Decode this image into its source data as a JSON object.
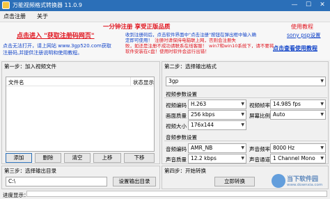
{
  "window": {
    "title": "万能视频格式转换器 11.0.9",
    "min": "—",
    "max": "☐",
    "close": "✕"
  },
  "menu": [
    "点击注册",
    "关于"
  ],
  "promo": {
    "headline": "一分钟注册   享受正版品质",
    "register_link": "点击进入 \"获取注册码网页\"",
    "line_left_1": "点击无法打开，请上网站 www.3gp520.com获取",
    "line_left_2": "注册码,并提供注册说明和使用教程。",
    "line_mid_1": "收到注册码后，点击软件界面中\"点击注册\"按钮在弹出框中输入确",
    "line_mid_2": "定即可使用！",
    "line_mid_red_1": "注册时请保持电脑联上网，否则会注册失",
    "line_mid_red_2": "败，如还是注册不成功请联系在线客服！",
    "line_mid_red_3": "win7和win10系统下，请不要将",
    "line_mid_red_4": "软件安装在c盘！使用时软件会运行出错！",
    "tutorial": "使用教程",
    "settings_link": "sony psp设置",
    "view_tutorial": "点击查看使用教程"
  },
  "step1": {
    "title": "第一步：加入视频文件",
    "col_file": "文件名",
    "col_status": "状态显示",
    "buttons": [
      "添加",
      "删除",
      "清空",
      "上移",
      "下移"
    ]
  },
  "step2": {
    "title": "第二步：选择输出格式",
    "format": "3gp",
    "video_group": "视频参数设置",
    "video_codec_label": "视频编码",
    "video_codec": "H.263",
    "video_fps_label": "视频帧率",
    "video_fps": "14.985 fps",
    "video_quality_label": "画面质量",
    "video_quality": "256 kbps",
    "aspect_label": "屏幕比例",
    "aspect": "Auto",
    "video_size_label": "视频大小",
    "video_size": "176x144",
    "audio_group": "音频参数设置",
    "audio_codec_label": "音频编码",
    "audio_codec": "AMR_NB",
    "sample_rate_label": "声音频率",
    "sample_rate": "8000 Hz",
    "audio_quality_label": "声音质量",
    "audio_quality": "12.2 kbps",
    "channel_label": "声音通道",
    "channel": "1 Channel Mono"
  },
  "step3": {
    "title": "第三步：选择输出目录",
    "path": "C:\\",
    "browse": "设置输出目录"
  },
  "step4": {
    "title": "第四步：开始转换",
    "start": "立即转换"
  },
  "progress": {
    "label": "进度显示：",
    "value": 0.0
  },
  "watermark": {
    "text": "当下软件园",
    "url": "www.downxia.com"
  },
  "colors": {
    "titlebar": "#2b6fb8",
    "red": "#e0141e",
    "blue": "#1244c8",
    "progress": "#06b025"
  }
}
